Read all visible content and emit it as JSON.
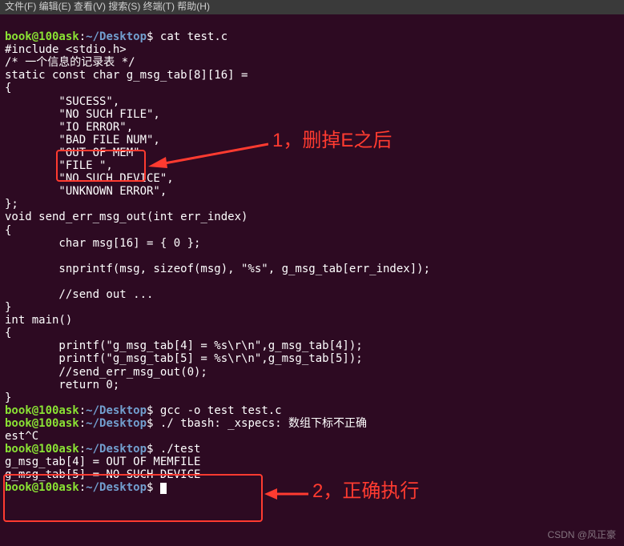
{
  "menu": "文件(F)  编辑(E)  查看(V)  搜索(S)  终端(T)  帮助(H)",
  "prompt": {
    "user": "book@100ask",
    "colon": ":",
    "path": "~/Desktop",
    "dollar": "$"
  },
  "cmds": {
    "cat": "cat test.c",
    "gcc": "gcc -o test test.c",
    "bad": "./ tbash: _xspecs: 数组下标不正确",
    "est": "est^C",
    "run": "./test"
  },
  "src": [
    "#include <stdio.h>",
    "/* 一个信息的记录表 */",
    "static const char g_msg_tab[8][16] =",
    "{",
    "        \"SUCESS\",",
    "        \"NO SUCH FILE\",",
    "        \"IO ERROR\",",
    "        \"BAD FILE NUM\",",
    "        \"OUT OF MEM\"",
    "        \"FILE \",",
    "        \"NO SUCH DEVICE\",",
    "        \"UNKNOWN ERROR\",",
    "};",
    "void send_err_msg_out(int err_index)",
    "{",
    "        char msg[16] = { 0 };",
    "",
    "        snprintf(msg, sizeof(msg), \"%s\", g_msg_tab[err_index]);",
    "",
    "        //send out ...",
    "}",
    "int main()",
    "{",
    "        printf(\"g_msg_tab[4] = %s\\r\\n\",g_msg_tab[4]);",
    "        printf(\"g_msg_tab[5] = %s\\r\\n\",g_msg_tab[5]);",
    "        //send_err_msg_out(0);",
    "        return 0;",
    "}"
  ],
  "out": [
    "g_msg_tab[4] = OUT OF MEMFILE ",
    "g_msg_tab[5] = NO SUCH DEVICE"
  ],
  "anno": {
    "a1": "1，删掉E之后",
    "a2": "2，正确执行"
  },
  "watermark": "CSDN @风正豪"
}
